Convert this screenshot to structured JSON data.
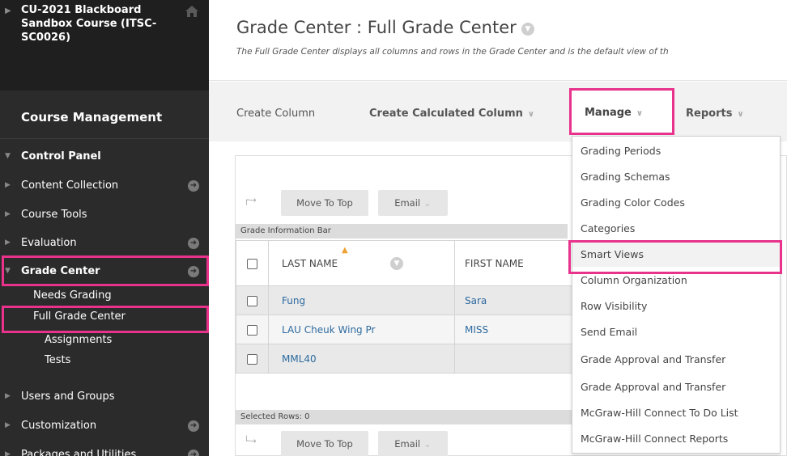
{
  "sidebar": {
    "course_title": "CU-2021 Blackboard Sandbox Course (ITSC-SC0026)",
    "course_management": "Course Management",
    "items": [
      {
        "label": "Control Panel"
      },
      {
        "label": "Content Collection"
      },
      {
        "label": "Course Tools"
      },
      {
        "label": "Evaluation"
      },
      {
        "label": "Grade Center"
      },
      {
        "label": "Users and Groups"
      },
      {
        "label": "Customization"
      },
      {
        "label": "Packages and Utilities"
      }
    ],
    "grade_center_sub": [
      "Needs Grading",
      "Full Grade Center",
      "Assignments",
      "Tests"
    ]
  },
  "header": {
    "title": "Grade Center : Full Grade Center",
    "subtitle": "The Full Grade Center displays all columns and rows in the Grade Center and is the default view of th"
  },
  "action_bar": {
    "create_column": "Create Column",
    "create_calculated_column": "Create Calculated Column",
    "manage": "Manage",
    "reports": "Reports"
  },
  "grid": {
    "move_to_top": "Move To Top",
    "email": "Email",
    "info_bar": "Grade Information Bar",
    "selected_rows": "Selected Rows: 0",
    "columns": [
      "LAST NAME",
      "FIRST NAME"
    ],
    "rows": [
      {
        "last": "Fung",
        "first": "Sara"
      },
      {
        "last": "LAU Cheuk Wing Pr",
        "first": "MISS"
      },
      {
        "last": "MML40",
        "first": ""
      }
    ]
  },
  "manage_menu": {
    "items": [
      "Grading Periods",
      "Grading Schemas",
      "Grading Color Codes",
      "Categories",
      "Smart Views",
      "Column Organization",
      "Row Visibility",
      "Send Email",
      "Grade Approval and Transfer",
      "Grade Approval and Transfer",
      "McGraw-Hill Connect To Do List",
      "McGraw-Hill Connect Reports"
    ]
  },
  "colors": {
    "highlight": "#e8328c",
    "sidebar_bg": "#2b2b2b",
    "link": "#2d6a9f"
  }
}
